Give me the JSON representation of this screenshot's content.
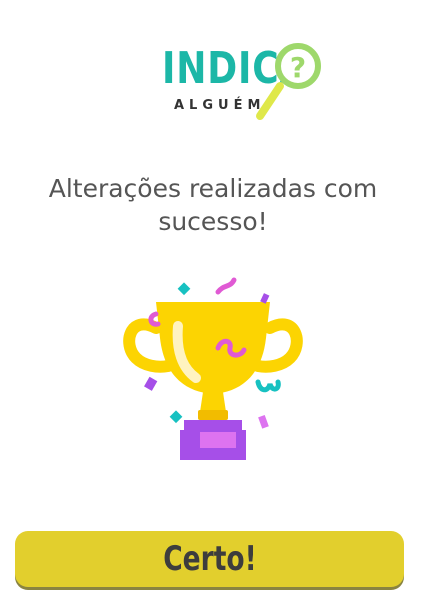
{
  "logo": {
    "wordmark": "INDICA",
    "subtitle": "ALGUÉM",
    "glass_symbol": "?",
    "colors": {
      "wordmark": "#1cb7a7",
      "glass": "#9ed86b",
      "handle": "#dfe84a",
      "subtitle": "#333333"
    }
  },
  "message": {
    "text": "Alterações realizadas com sucesso!"
  },
  "illustration": {
    "icon": "trophy-icon",
    "colors": {
      "cup": "#fcd402",
      "base": "#a64fe8",
      "confetti_teal": "#17c1c1",
      "confetti_pink": "#e05ad4"
    }
  },
  "button": {
    "label": "Certo!",
    "color": "#e2cf2d"
  }
}
